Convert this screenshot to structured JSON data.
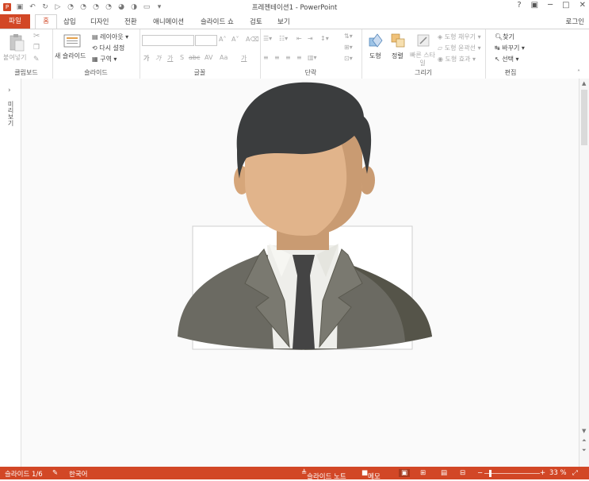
{
  "window": {
    "title": "프레젠테이션1 - PowerPoint",
    "help": "?",
    "minimize": "─",
    "maximize": "□",
    "close": "✕"
  },
  "tabs": {
    "file": "파일",
    "home": "홈",
    "items": [
      "삽입",
      "디자인",
      "전환",
      "애니메이션",
      "슬라이드 쇼",
      "검토",
      "보기"
    ],
    "login": "로그인"
  },
  "ribbon": {
    "clipboard": {
      "paste": "붙여넣기",
      "label": "클립보드"
    },
    "slides": {
      "new_slide": "새 슬라이드",
      "layout": "레이아웃",
      "reset": "다시 설정",
      "section": "구역",
      "label": "슬라이드"
    },
    "font": {
      "bold": "가",
      "italic": "가",
      "underline": "가",
      "shadow": "S",
      "strike": "abc",
      "spacing": "AV",
      "case": "Aa",
      "color": "가",
      "label": "글꼴"
    },
    "paragraph": {
      "label": "단락"
    },
    "drawing": {
      "shapes": "도형",
      "arrange": "정렬",
      "quick_styles": "빠른 스타일",
      "fill": "도형 채우기",
      "outline": "도형 윤곽선",
      "effects": "도형 효과",
      "label": "그리기"
    },
    "editing": {
      "find": "찾기",
      "replace": "바꾸기",
      "select": "선택",
      "label": "편집"
    }
  },
  "leftpanel": {
    "label": "미리보기"
  },
  "status": {
    "slide": "슬라이드 1/6",
    "language": "한국어",
    "notes": "슬라이드 노트",
    "comments": "메모",
    "zoom": "33 %"
  },
  "colors": {
    "accent": "#d24726",
    "hair": "#3b3d3e",
    "skin": "#e1b48b",
    "skin_shade": "#c99b72",
    "suit": "#6b6a62",
    "suit_dark": "#555449",
    "shirt": "#eeeeea",
    "tie": "#444444"
  }
}
